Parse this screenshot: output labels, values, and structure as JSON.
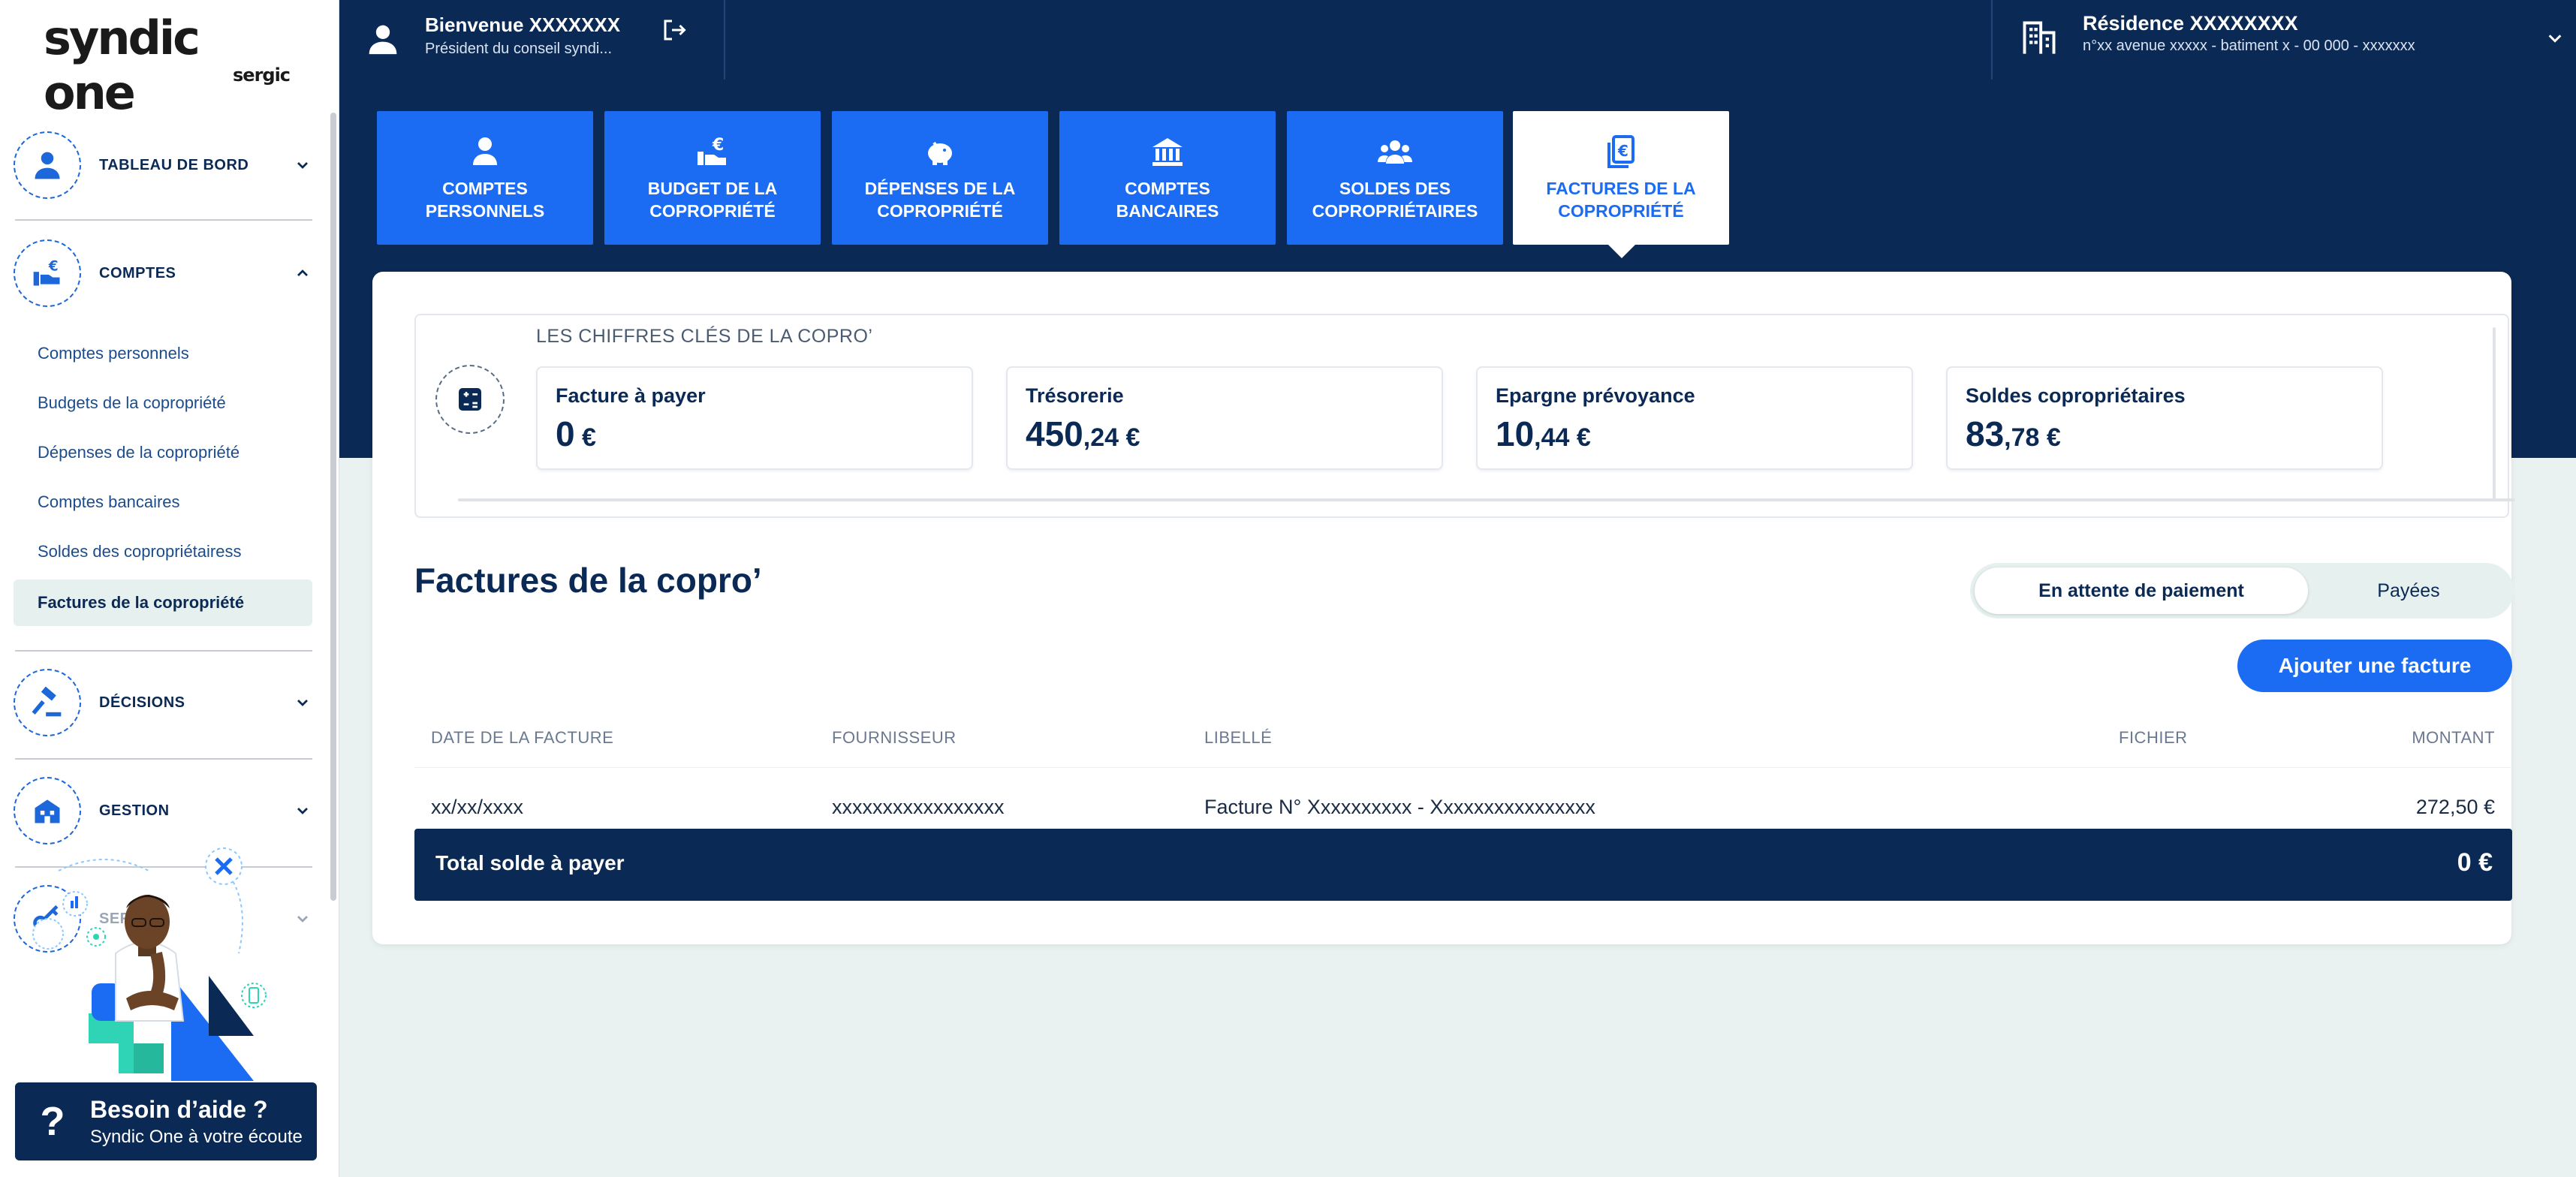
{
  "brand": {
    "name": "syndic one",
    "sub": "sergic"
  },
  "topbar": {
    "welcome": "Bienvenue XXXXXXX",
    "role": "Président du conseil syndi...",
    "residence_name": "Résidence XXXXXXXX",
    "residence_address": "n°xx avenue xxxxx - batiment x - 00 000 - xxxxxxx"
  },
  "sidebar": {
    "sections": [
      {
        "label": "TABLEAU DE BORD",
        "icon": "user-icon",
        "expanded": false
      },
      {
        "label": "COMPTES",
        "icon": "hand-euro-icon",
        "expanded": true
      },
      {
        "label": "DÉCISIONS",
        "icon": "gavel-icon",
        "expanded": false
      },
      {
        "label": "GESTION",
        "icon": "building-icon",
        "expanded": false
      },
      {
        "label": "SERVI",
        "icon": "key-icon",
        "expanded": false
      }
    ],
    "sub_items": [
      "Comptes personnels",
      "Budgets de la copropriété",
      "Dépenses de la copropriété",
      "Comptes bancaires",
      "Soldes des copropriétairess",
      "Factures de la copropriété"
    ],
    "active_sub_item": "Factures de la copropriété",
    "help": {
      "title": "Besoin d’aide ?",
      "subtitle": "Syndic One à votre écoute",
      "icon": "question-icon"
    }
  },
  "tabs": [
    {
      "line1": "COMPTES",
      "line2": "PERSONNELS",
      "icon": "user-icon"
    },
    {
      "line1": "BUDGET DE LA",
      "line2": "COPROPRIÉTÉ",
      "icon": "hand-euro-icon"
    },
    {
      "line1": "DÉPENSES DE LA",
      "line2": "COPROPRIÉTÉ",
      "icon": "piggy-bank-icon"
    },
    {
      "line1": "COMPTES",
      "line2": "BANCAIRES",
      "icon": "bank-icon"
    },
    {
      "line1": "SOLDES DES",
      "line2": "COPROPRIÉTAIRES",
      "icon": "users-icon"
    },
    {
      "line1": "FACTURES DE LA",
      "line2": "COPROPRIÉTÉ",
      "icon": "invoice-euro-icon",
      "active": true
    }
  ],
  "kpis": {
    "heading": "LES CHIFFRES CLÉS DE LA COPRO’",
    "items": [
      {
        "label": "Facture à payer",
        "int": "0",
        "dec": " €"
      },
      {
        "label": "Trésorerie",
        "int": "450",
        "dec": ",24 €"
      },
      {
        "label": "Epargne prévoyance",
        "int": "10",
        "dec": ",44 €"
      },
      {
        "label": "Soldes copropriétaires",
        "int": "83",
        "dec": ",78 €"
      }
    ]
  },
  "invoices": {
    "title": "Factures de la copro’",
    "toggle": {
      "pending": "En attente de paiement",
      "paid": "Payées"
    },
    "add_button": "Ajouter une facture",
    "columns": [
      "DATE DE LA FACTURE",
      "FOURNISSEUR",
      "LIBELLÉ",
      "FICHIER",
      "MONTANT"
    ],
    "rows": [
      {
        "date": "xx/xx/xxxx",
        "supplier": "xxxxxxxxxxxxxxxxx",
        "label": "Facture N° Xxxxxxxxxx  - Xxxxxxxxxxxxxxxx",
        "file": "",
        "amount": "272,50 €"
      }
    ],
    "total_label": "Total solde à payer",
    "total_value": "0 €"
  },
  "colors": {
    "navy": "#0a2a55",
    "blue": "#1b6cf2",
    "mint": "#e6f0ef",
    "teal": "#2fd3b5"
  }
}
